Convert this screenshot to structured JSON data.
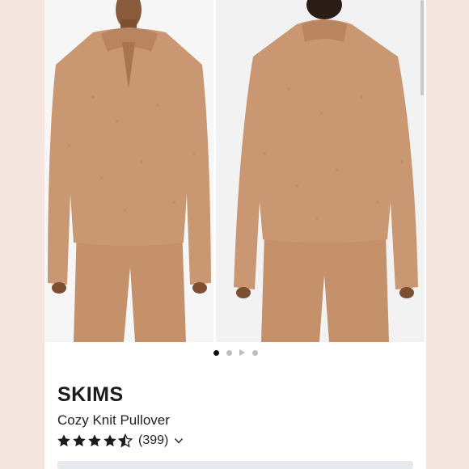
{
  "gallery": {
    "image_count": 4,
    "active_index": 0,
    "images": [
      {
        "label": "front-view-photo"
      },
      {
        "label": "back-view-photo"
      }
    ]
  },
  "product": {
    "brand": "SKIMS",
    "name": "Cozy Knit Pullover",
    "rating_stars": 4.5,
    "review_count": "(399)"
  },
  "colors": {
    "garment": "#c99872",
    "background": "#f4e6de",
    "active_dot": "#111111"
  },
  "icons": {
    "stars": "star-icon",
    "expand": "chevron-down-icon",
    "video": "play-icon"
  }
}
